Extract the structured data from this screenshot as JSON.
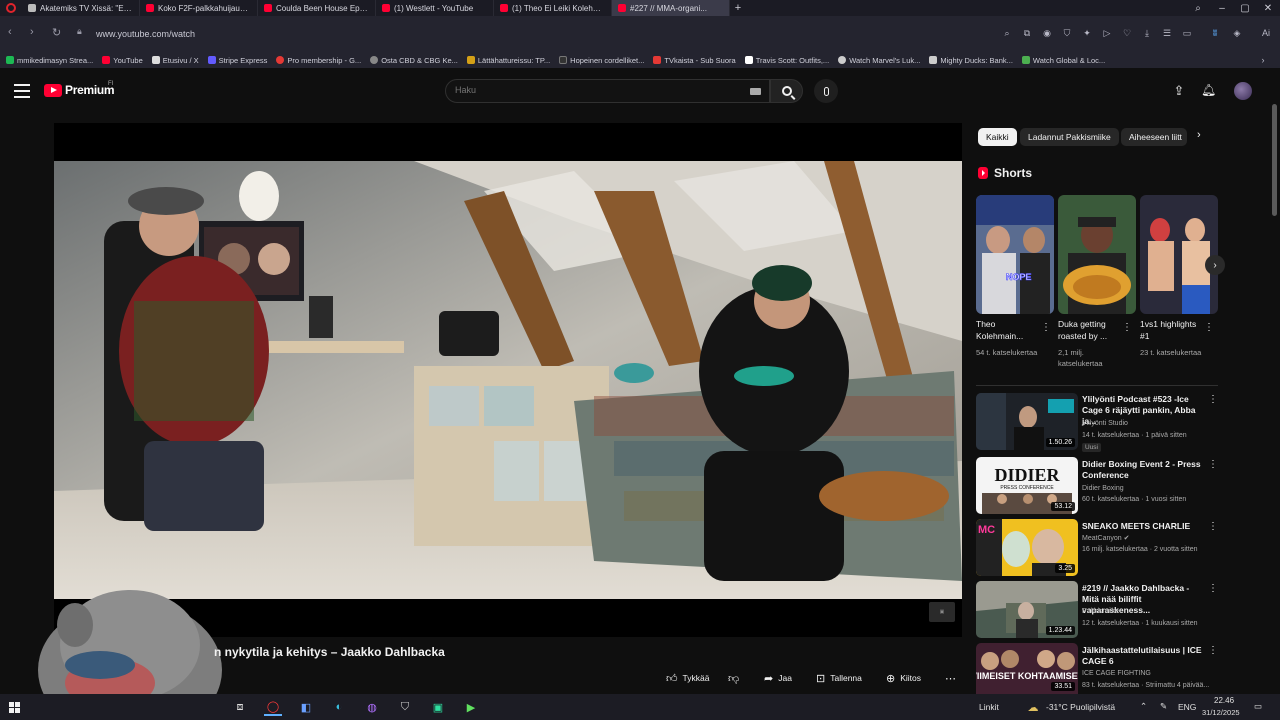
{
  "browser": {
    "tabs": [
      {
        "label": "Akatemiks TV Xissä: \"En S...",
        "color": "#bbbbbb"
      },
      {
        "label": "Koko F2F-palkkahuijaus -...",
        "color": "#ff0033"
      },
      {
        "label": "Coulda Been House Episo...",
        "color": "#ff0033"
      },
      {
        "label": "(1) Westlett - YouTube",
        "color": "#ff0033"
      },
      {
        "label": "(1) Theo Ei Leiki Kolehmai...",
        "color": "#ff0033"
      },
      {
        "label": "#227 // MMA-organi...",
        "color": "#ff0033"
      }
    ],
    "url": "www.youtube.com/watch",
    "bookmarks": [
      {
        "label": "mmikedimasyn Strea...",
        "color": "#1db954"
      },
      {
        "label": "YouTube",
        "color": "#ff0033"
      },
      {
        "label": "Etusivu / X",
        "color": "#dddddd"
      },
      {
        "label": "Stripe Express",
        "color": "#635bff"
      },
      {
        "label": "Pro membership - G...",
        "color": "#e53935"
      },
      {
        "label": "Osta CBD & CBG Ke...",
        "color": "#888888"
      },
      {
        "label": "Lättähattureissu: TP...",
        "color": "#d4a017"
      },
      {
        "label": "Hopeinen cordelliket...",
        "color": "#333333"
      },
      {
        "label": "TVkaista - Sub Suora",
        "color": "#e53935"
      },
      {
        "label": "Travis Scott: Outfits,...",
        "color": "#ffffff"
      },
      {
        "label": "Watch Marvel's Luk...",
        "color": "#cccccc"
      },
      {
        "label": "Mighty Ducks: Bank...",
        "color": "#cccccc"
      },
      {
        "label": "Watch Global & Loc...",
        "color": "#4caf50"
      }
    ]
  },
  "youtube": {
    "logo_text": "Premium",
    "logo_region": "FI",
    "search_placeholder": "Haku",
    "video_title": "n nykytila ja kehitys – Jaakko Dahlbacka",
    "actions": {
      "like": "Tykkää",
      "share": "Jaa",
      "save": "Tallenna",
      "thanks": "Kiitos"
    },
    "chips": [
      "Kaikki",
      "Ladannut Pakkismiike",
      "Aiheeseen liitt"
    ],
    "shorts_heading": "Shorts",
    "shorts": [
      {
        "title": "Theo Kolehmain...",
        "views": "54 t. katselukertaa",
        "overlay": "NOPE"
      },
      {
        "title": "Duka getting roasted by ...",
        "views": "2,1 milj. katselukertaa",
        "overlay": ""
      },
      {
        "title": "1vs1 highlights #1",
        "views": "23 t. katselukertaa",
        "overlay": ""
      }
    ],
    "recommendations": [
      {
        "title": "Ylilyönti Podcast #523 -Ice Cage 6 räjäytti pankin, Abba ja...",
        "channel": "Ylilyönti Studio",
        "meta": "14 t. katselukertaa · 1 päivä sitten",
        "duration": "1.50.26",
        "badge": "Uusi"
      },
      {
        "title": "Didier Boxing Event 2 - Press Conference",
        "channel": "Didier Boxing",
        "meta": "60 t. katselukertaa · 1 vuosi sitten",
        "duration": "53.12",
        "badge": ""
      },
      {
        "title": "SNEAKO MEETS CHARLIE",
        "channel": "MeatCanyon",
        "meta": "16 milj. katselukertaa · 2 vuotta sitten",
        "duration": "3.25",
        "badge": ""
      },
      {
        "title": "#219 // Jaakko Dahlbacka - Mitä nää biliffit vaparaskeness...",
        "channel": "Pakkismiike",
        "meta": "12 t. katselukertaa · 1 kuukausi sitten",
        "duration": "1.23.44",
        "badge": ""
      },
      {
        "title": "Jälkihaastattelutilaisuus | ICE CAGE 6",
        "channel": "ICE CAGE FIGHTING",
        "meta": "83 t. katselukertaa · Striimattu 4 päivää...",
        "duration": "33.51",
        "badge": ""
      }
    ],
    "thumb_texts": {
      "didier": "DIDIER",
      "didier_sub": "PRESS CONFERENCE",
      "viimeiset": "VIIMEISET KOHTAAMISET",
      "mc": "MC"
    }
  },
  "taskbar": {
    "links": "Linkit",
    "weather": "-31°C  Puolipilvistä",
    "lang": "ENG",
    "time": "22.46",
    "date": "31/12/2025"
  }
}
